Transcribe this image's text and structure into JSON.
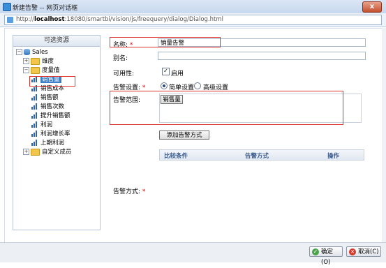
{
  "window": {
    "title": "新建告警 -- 网页对话框",
    "close_label": "x"
  },
  "address": {
    "prefix": "http://",
    "host": "localhost",
    "rest": ":18080/smartbi/vision/js/freequery/dialog/Dialog.html"
  },
  "resources": {
    "header": "可选资源",
    "root": "Sales",
    "items": [
      {
        "label": "维度",
        "kind": "folder"
      },
      {
        "label": "度量值",
        "kind": "folder"
      },
      {
        "label": "销售量",
        "kind": "measure"
      },
      {
        "label": "销售成本",
        "kind": "measure"
      },
      {
        "label": "销售额",
        "kind": "measure"
      },
      {
        "label": "销售次数",
        "kind": "measure"
      },
      {
        "label": "提升销售额",
        "kind": "measure"
      },
      {
        "label": "利润",
        "kind": "measure"
      },
      {
        "label": "利润增长率",
        "kind": "measure"
      },
      {
        "label": "上期利润",
        "kind": "measure"
      },
      {
        "label": "自定义成员",
        "kind": "folder"
      }
    ]
  },
  "form": {
    "name_label": "名称:",
    "required_mark": "*",
    "name_value": "销量告警",
    "alias_label": "别名:",
    "alias_value": "",
    "availability_label": "可用性:",
    "enabled_label": "启用",
    "enabled_check": "✓",
    "setting_label": "告警设置:",
    "setting_options": [
      "简单设置",
      "高级设置"
    ],
    "range_label": "告警范围:",
    "range_tag": "销售量",
    "add_method_button": "添加告警方式",
    "method_label": "告警方式:",
    "table_columns": [
      "比较条件",
      "告警方式",
      "操作"
    ]
  },
  "footer": {
    "ok_label": "确定(O)",
    "cancel_label": "取消(C)",
    "ok_icon": "✓",
    "cancel_icon": "✕"
  }
}
